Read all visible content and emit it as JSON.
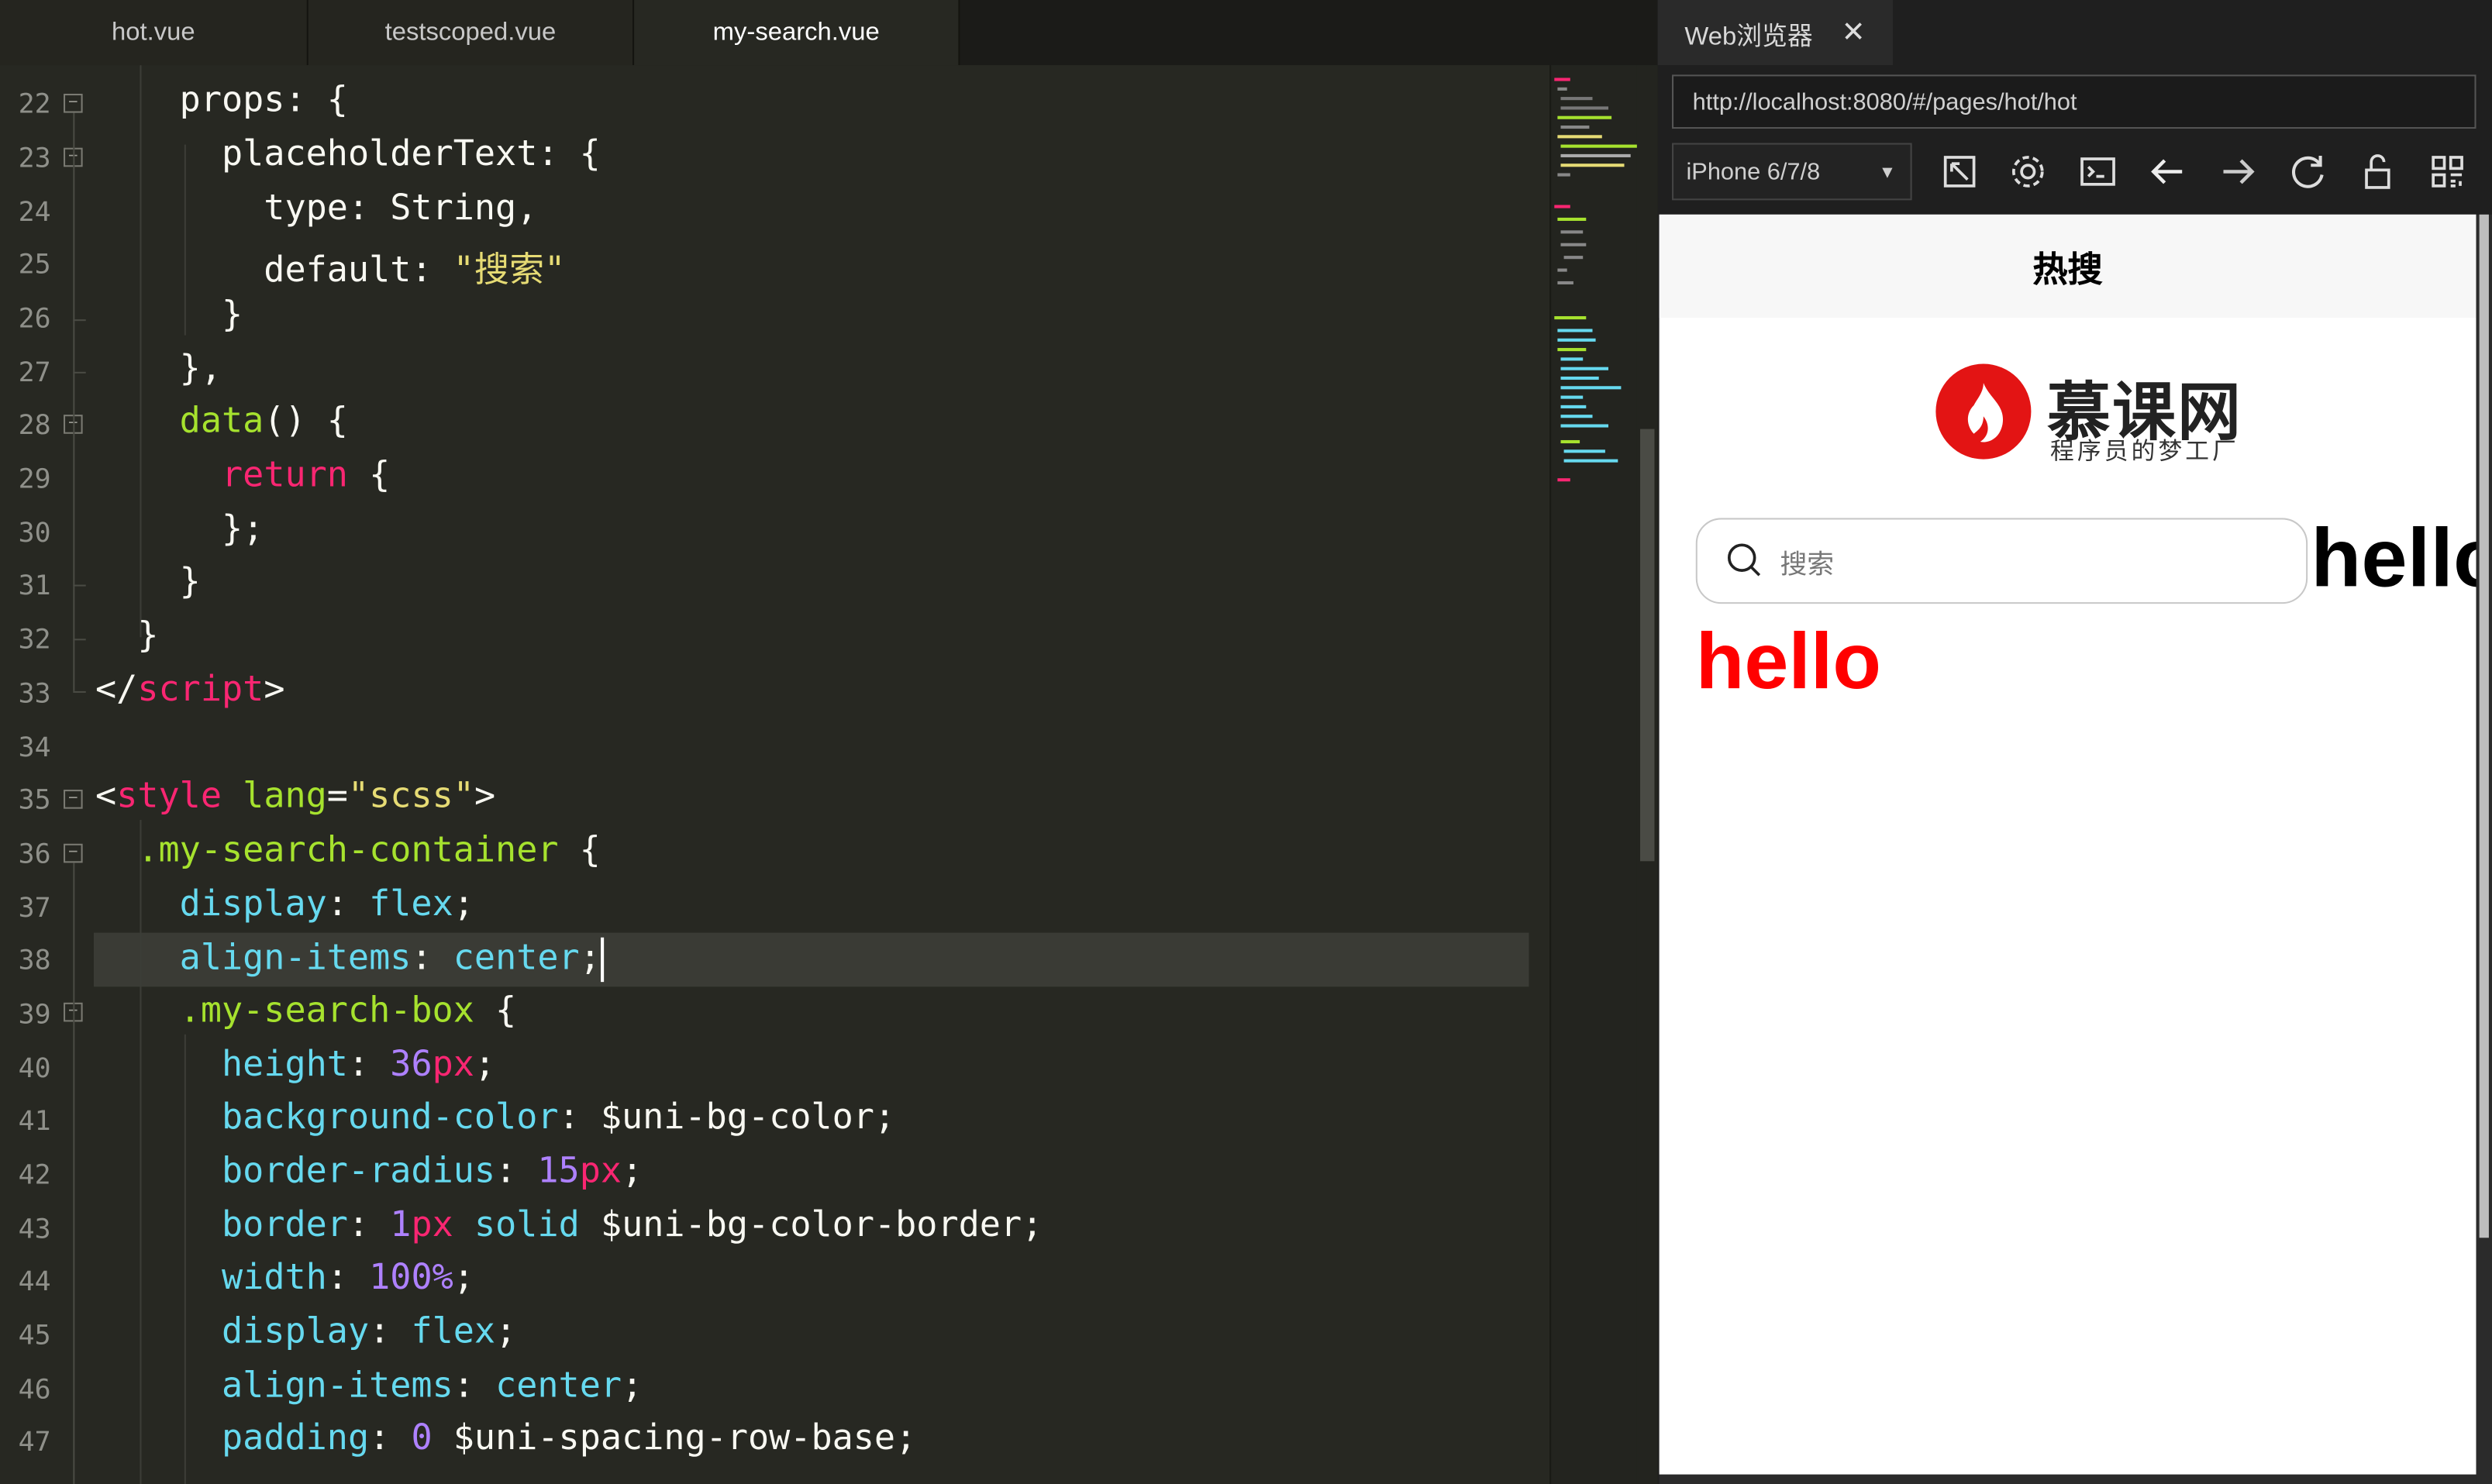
{
  "editor": {
    "tabs": [
      {
        "label": "hot.vue"
      },
      {
        "label": "testscoped.vue"
      },
      {
        "label": "my-search.vue"
      }
    ],
    "active_tab": "my-search.vue",
    "current_line": 38
  },
  "browser": {
    "tab_title": "Web浏览器",
    "close_icon": "close-icon",
    "url": "http://localhost:8080/#/pages/hot/hot",
    "device": "iPhone 6/7/8",
    "toolbar_icons": [
      "rotate-icon",
      "settings-icon",
      "console-icon",
      "back-arrow-icon",
      "forward-arrow-icon",
      "refresh-icon",
      "unlock-icon",
      "qrcode-icon"
    ]
  },
  "phone": {
    "nav_title": "热搜",
    "logo_title": "慕课网",
    "logo_subtitle": "程序员的梦工厂",
    "search_placeholder": "搜索",
    "hello_black": "hello",
    "hello_red": "hello"
  },
  "colors": {
    "editor_bg": "#272822",
    "keyword": "#66d9ef",
    "string": "#e6db74",
    "number": "#ae81ff",
    "tag": "#f92672",
    "function": "#a6e22e",
    "hello_red": "#ff0000"
  }
}
